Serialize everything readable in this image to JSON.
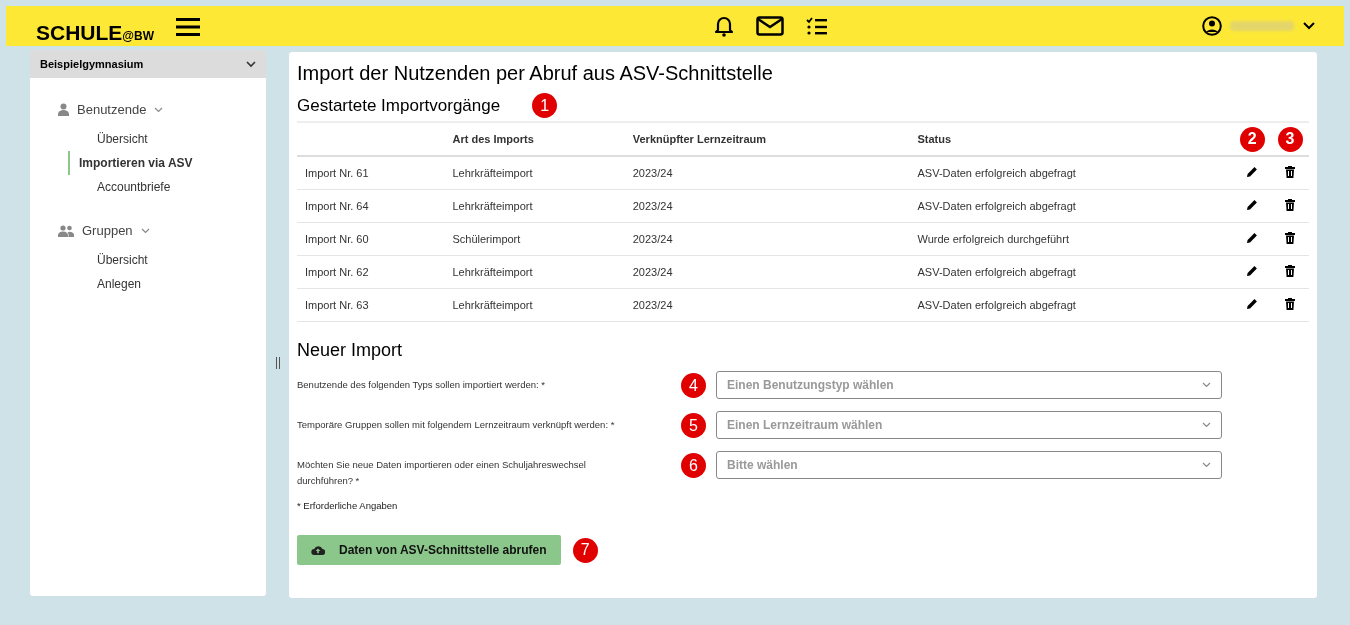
{
  "header": {
    "logo": "SCHULE",
    "logo_suffix": "@BW"
  },
  "sidebar": {
    "school": "Beispielgymnasium",
    "sections": [
      {
        "label": "Benutzende",
        "kind": "user",
        "expanded": true,
        "items": [
          {
            "label": "Übersicht",
            "selected": false
          },
          {
            "label": "Importieren via ASV",
            "selected": true
          },
          {
            "label": "Accountbriefe",
            "selected": false
          }
        ]
      },
      {
        "label": "Gruppen",
        "kind": "group",
        "expanded": true,
        "items": [
          {
            "label": "Übersicht",
            "selected": false
          },
          {
            "label": "Anlegen",
            "selected": false
          }
        ]
      }
    ]
  },
  "main": {
    "title": "Import der Nutzenden per Abruf aus ASV-Schnittstelle",
    "section_title": "Gestartete Importvorgänge",
    "section_marker": "1",
    "table": {
      "columns": [
        "Art des Imports",
        "Verknüpfter Lernzeitraum",
        "Status"
      ],
      "action_markers": [
        "2",
        "3"
      ],
      "rows": [
        {
          "name": "Import Nr. 61",
          "type": "Lehrkräfteimport",
          "period": "2023/24",
          "status": "ASV-Daten erfolgreich abgefragt"
        },
        {
          "name": "Import Nr. 64",
          "type": "Lehrkräfteimport",
          "period": "2023/24",
          "status": "ASV-Daten erfolgreich abgefragt"
        },
        {
          "name": "Import Nr. 60",
          "type": "Schülerimport",
          "period": "2023/24",
          "status": "Wurde erfolgreich durchgeführt"
        },
        {
          "name": "Import Nr. 62",
          "type": "Lehrkräfteimport",
          "period": "2023/24",
          "status": "ASV-Daten erfolgreich abgefragt"
        },
        {
          "name": "Import Nr. 63",
          "type": "Lehrkräfteimport",
          "period": "2023/24",
          "status": "ASV-Daten erfolgreich abgefragt"
        }
      ]
    },
    "new_import": {
      "title": "Neuer Import",
      "fields": [
        {
          "label": "Benutzende des folgenden Typs sollen importiert werden: *",
          "marker": "4",
          "placeholder": "Einen Benutzungstyp wählen"
        },
        {
          "label": "Temporäre Gruppen sollen mit folgendem Lernzeitraum verknüpft werden: *",
          "marker": "5",
          "placeholder": "Einen Lernzeitraum wählen"
        },
        {
          "label": "Möchten Sie neue Daten importieren oder einen Schuljahreswechsel durchführen? *",
          "marker": "6",
          "placeholder": "Bitte wählen"
        }
      ],
      "required_note": "* Erforderliche Angaben",
      "button": "Daten von ASV-Schnittstelle abrufen",
      "button_marker": "7"
    }
  }
}
